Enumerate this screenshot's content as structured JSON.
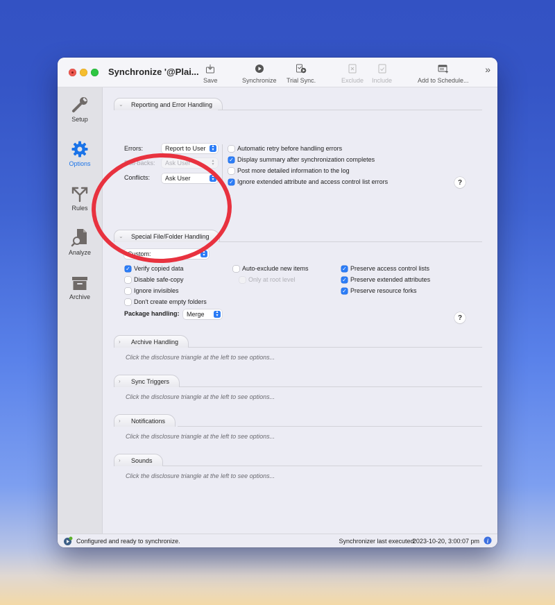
{
  "window": {
    "title": "Synchronize '@Plai...",
    "toolbar": [
      {
        "id": "save",
        "label": "Save",
        "icon": "save-icon",
        "enabled": true
      },
      {
        "id": "synchronize",
        "label": "Synchronize",
        "icon": "play-icon",
        "enabled": true
      },
      {
        "id": "trial-sync",
        "label": "Trial Sync.",
        "icon": "trial-sync-icon",
        "enabled": true
      },
      {
        "id": "exclude",
        "label": "Exclude",
        "icon": "exclude-file-icon",
        "enabled": false
      },
      {
        "id": "include",
        "label": "Include",
        "icon": "include-file-icon",
        "enabled": false
      },
      {
        "id": "add-to-schedule",
        "label": "Add to Schedule...",
        "icon": "calendar-add-icon",
        "enabled": true
      }
    ],
    "overflow_glyph": "»"
  },
  "sidebar": {
    "items": [
      {
        "id": "setup",
        "label": "Setup",
        "icon": "wrench-icon",
        "selected": false
      },
      {
        "id": "options",
        "label": "Options",
        "icon": "gear-icon",
        "selected": true
      },
      {
        "id": "rules",
        "label": "Rules",
        "icon": "fork-arrows-icon",
        "selected": false
      },
      {
        "id": "analyze",
        "label": "Analyze",
        "icon": "document-magnifier-icon",
        "selected": false
      },
      {
        "id": "archive",
        "label": "Archive",
        "icon": "archive-box-icon",
        "selected": false
      }
    ]
  },
  "sections": {
    "reporting": {
      "title": "Reporting and Error Handling",
      "expanded": true,
      "errors_label": "Errors:",
      "errors_value": "Report to User",
      "rollbacks_label": "Roll-backs:",
      "rollbacks_value": "Ask User",
      "conflicts_label": "Conflicts:",
      "conflicts_value": "Ask User",
      "checkboxes": [
        {
          "label": "Automatic retry before handling errors",
          "checked": false
        },
        {
          "label": "Display summary after synchronization completes",
          "checked": true
        },
        {
          "label": "Post more detailed information to the log",
          "checked": false
        },
        {
          "label": "Ignore extended attribute and access control list errors",
          "checked": true
        }
      ],
      "help": "?"
    },
    "special": {
      "title": "Special File/Folder Handling",
      "expanded": true,
      "preset_value": "Custom:",
      "left_checkboxes": [
        {
          "label": "Verify copied data",
          "checked": true
        },
        {
          "label": "Disable safe-copy",
          "checked": false
        },
        {
          "label": "Ignore invisibles",
          "checked": false
        },
        {
          "label": "Don't create empty folders",
          "checked": false
        }
      ],
      "mid_checkboxes": [
        {
          "label": "Auto-exclude new items",
          "checked": false,
          "enabled": true
        },
        {
          "label": "Only at root level",
          "checked": false,
          "enabled": false
        }
      ],
      "right_checkboxes": [
        {
          "label": "Preserve access control lists",
          "checked": true
        },
        {
          "label": "Preserve extended attributes",
          "checked": true
        },
        {
          "label": "Preserve resource forks",
          "checked": true
        }
      ],
      "package_label": "Package handling:",
      "package_value": "Merge",
      "help": "?"
    },
    "collapsed": [
      {
        "title": "Archive Handling",
        "hint": "Click the disclosure triangle at the left to see options..."
      },
      {
        "title": "Sync Triggers",
        "hint": "Click the disclosure triangle at the left to see options..."
      },
      {
        "title": "Notifications",
        "hint": "Click the disclosure triangle at the left to see options..."
      },
      {
        "title": "Sounds",
        "hint": "Click the disclosure triangle at the left to see options..."
      }
    ]
  },
  "status": {
    "message": "Configured and ready to synchronize.",
    "last_executed_label": "Synchronizer last executed:",
    "last_executed_value": "2023-10-20, 3:00:07 pm"
  },
  "annotation": {
    "shape": "ellipse",
    "color": "#e8323f",
    "target": "Special File/Folder Handling"
  },
  "colors": {
    "accent": "#2b7cf6",
    "selected_sidebar": "#1a73e8",
    "icon_gray": "#6f6a68"
  }
}
